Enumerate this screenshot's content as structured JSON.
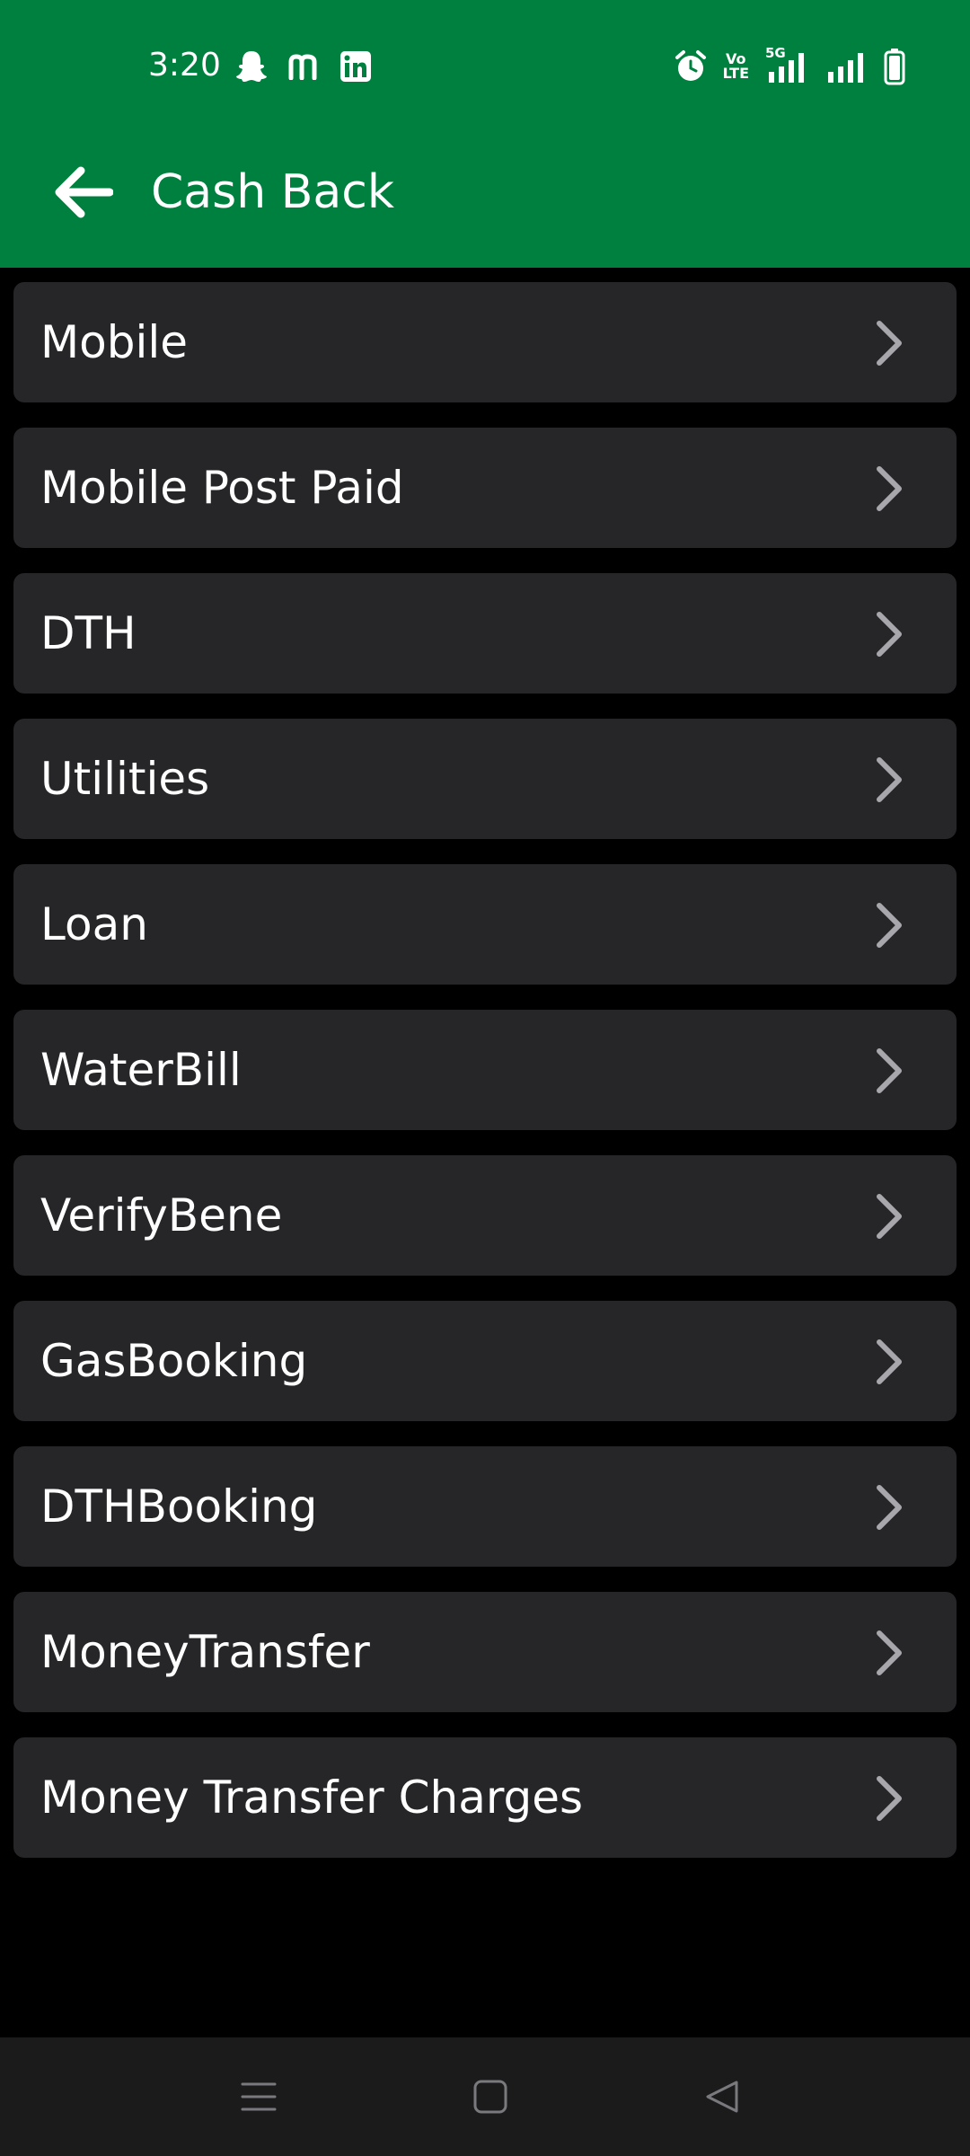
{
  "status_bar": {
    "time": "3:20",
    "left_icons": [
      "snapchat-icon",
      "m-app-icon",
      "linkedin-icon"
    ],
    "right_icons": [
      "alarm-icon",
      "volte-icon",
      "signal-5g-icon",
      "signal-icon",
      "battery-icon"
    ],
    "volte_text_top": "Vo",
    "volte_text_bottom": "LTE",
    "network_label": "5G"
  },
  "app_bar": {
    "title": "Cash Back",
    "back_icon": "arrow-left-icon",
    "background": "#00803f"
  },
  "list": {
    "items": [
      {
        "label": "Mobile"
      },
      {
        "label": "Mobile Post Paid"
      },
      {
        "label": "DTH"
      },
      {
        "label": "Utilities"
      },
      {
        "label": "Loan"
      },
      {
        "label": "WaterBill"
      },
      {
        "label": "VerifyBene"
      },
      {
        "label": "GasBooking"
      },
      {
        "label": "DTHBooking"
      },
      {
        "label": "MoneyTransfer"
      },
      {
        "label": "Money Transfer Charges"
      }
    ],
    "item_background": "#262629",
    "chevron_icon": "chevron-right-icon"
  },
  "nav_bar": {
    "buttons": [
      "menu-icon",
      "home-square-icon",
      "back-triangle-icon"
    ]
  }
}
